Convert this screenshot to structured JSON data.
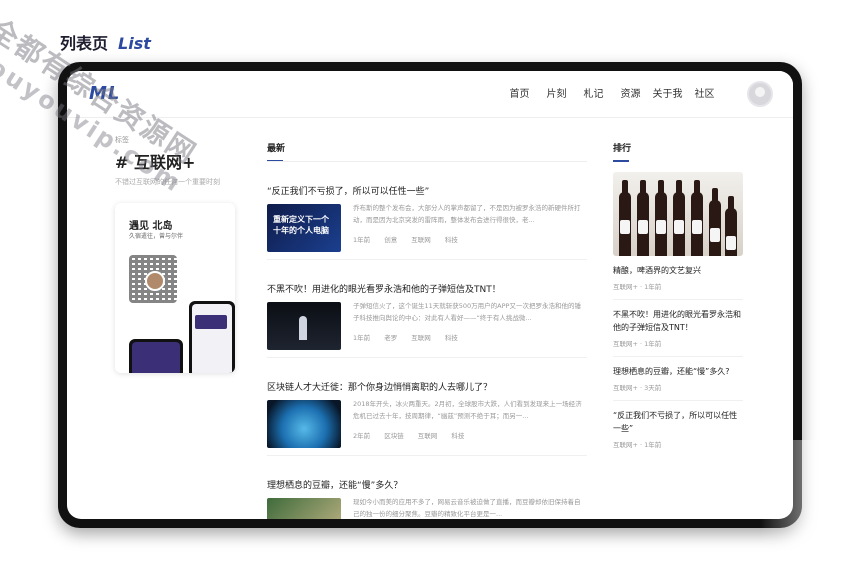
{
  "page_heading": {
    "cn": "列表页",
    "en": "List"
  },
  "watermark": {
    "line1": "全都有综合资源网",
    "line2": "douyouvip.com"
  },
  "navbar": {
    "logo": "ML",
    "items": [
      "首页",
      "片刻",
      "札记",
      "资源",
      "关于我",
      "社区"
    ]
  },
  "tag": {
    "label": "标签",
    "title": "# 互联网+",
    "desc": "不错过互联网的任何一个重要时刻"
  },
  "promo": {
    "title": "遇见 北岛",
    "subtitle": "久宿遣往，曾与尔伴"
  },
  "main": {
    "section_title": "最新",
    "articles": [
      {
        "title": "“反正我们不亏损了，所以可以任性一些”",
        "thumb_text": "重新定义下一个十年的个人电脑",
        "excerpt": "乔布斯的整个发布会，大部分人的掌声都留了，不是因为被罗永浩的新硬件所打动，而是因为北京突发的雷阵雨，整体发布会进行得很快，老...",
        "meta": [
          "1年前",
          "创意",
          "互联网",
          "科技"
        ]
      },
      {
        "title": "不黑不吹！用进化的眼光看罗永浩和他的子弹短信及TNT！",
        "excerpt": "子弹短信火了，这个诞生11天就斩获500万用户的APP又一次把罗永浩和他的锤子科技推向舆论的中心：对此有人看好——“终于有人挑战微...",
        "meta": [
          "1年前",
          "老罗",
          "互联网",
          "科技"
        ]
      },
      {
        "title": "区块链人才大迁徙：那个你身边悄悄离职的人去哪儿了？",
        "excerpt": "2018年开头，冰火两重天。2月初，全球股市大跌，人们看到发现来上一场经济危机已过去十年，技周期律，“幽兹”预测不绝于耳；而另一...",
        "meta": [
          "2年前",
          "区块链",
          "互联网",
          "科技"
        ]
      },
      {
        "title": "理想栖息的豆瓣，还能“慢”多久？",
        "excerpt": "现如今小而美的应用不多了，网易云音乐被迫做了直播，而豆瓣却依旧保持着自己的独一份的细分聚焦。豆瓣的精致化平台更是一...",
        "meta": []
      }
    ]
  },
  "side": {
    "section_title": "排行",
    "items": [
      {
        "title": "精酿，啤酒界的文艺复兴",
        "meta": "互联网+ · 1年前"
      },
      {
        "title": "不黑不吹！用进化的眼光看罗永浩和他的子弹短信及TNT！",
        "meta": "互联网+ · 1年前"
      },
      {
        "title": "理想栖息的豆瓣，还能“慢”多久?",
        "meta": "互联网+ · 3天前"
      },
      {
        "title": "“反正我们不亏损了，所以可以任性一些”",
        "meta": "互联网+ · 1年前"
      }
    ]
  }
}
